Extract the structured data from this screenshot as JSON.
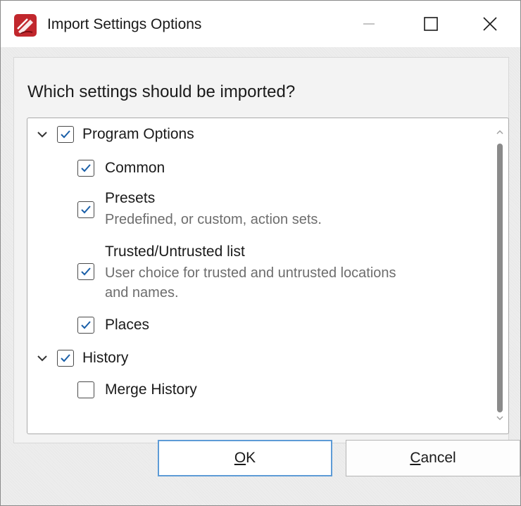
{
  "window": {
    "title": "Import Settings Options",
    "controls": {
      "minimize": "minimize-icon",
      "maximize": "maximize-icon",
      "close": "close-icon"
    }
  },
  "prompt": "Which settings should be imported?",
  "tree": {
    "groups": [
      {
        "label": "Program Options",
        "checked": true,
        "expanded": true,
        "items": [
          {
            "label": "Common",
            "checked": true
          },
          {
            "label": "Presets",
            "description": "Predefined, or custom, action sets.",
            "checked": true
          },
          {
            "label": "Trusted/Untrusted list",
            "description_line1": "User choice for trusted and untrusted locations",
            "description_line2": "and names.",
            "checked": true
          },
          {
            "label": "Places",
            "checked": true
          }
        ]
      },
      {
        "label": "History",
        "checked": true,
        "expanded": true,
        "items": [
          {
            "label": "Merge History",
            "checked": false
          }
        ]
      }
    ]
  },
  "buttons": {
    "ok": "OK",
    "cancel": "Cancel"
  },
  "colors": {
    "accent": "#5d9bd6",
    "check": "#1a5fa8",
    "app_icon": "#c1272d"
  }
}
